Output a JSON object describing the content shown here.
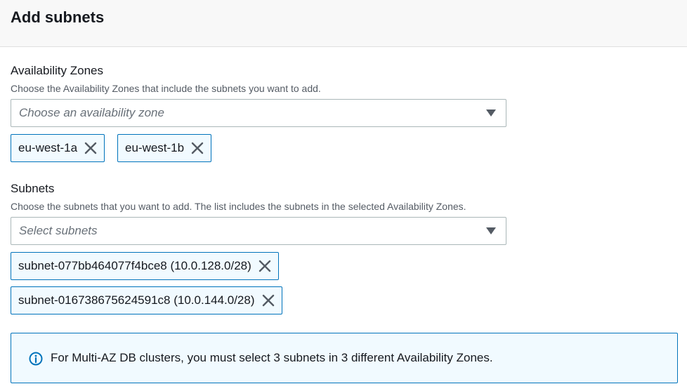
{
  "header": {
    "title": "Add subnets"
  },
  "availability_zones": {
    "label": "Availability Zones",
    "description": "Choose the Availability Zones that include the subnets you want to add.",
    "placeholder": "Choose an availability zone",
    "selected": [
      "eu-west-1a",
      "eu-west-1b"
    ]
  },
  "subnets": {
    "label": "Subnets",
    "description": "Choose the subnets that you want to add. The list includes the subnets in the selected Availability Zones.",
    "placeholder": "Select subnets",
    "selected": [
      "subnet-077bb464077f4bce8 (10.0.128.0/28)",
      "subnet-016738675624591c8 (10.0.144.0/28)"
    ]
  },
  "alert": {
    "icon": "info-icon",
    "text": "For Multi-AZ DB clusters, you must select 3 subnets in 3 different Availability Zones."
  },
  "colors": {
    "accent": "#0073bb",
    "token_background": "#f1faff",
    "header_background": "#f8f8f8"
  }
}
